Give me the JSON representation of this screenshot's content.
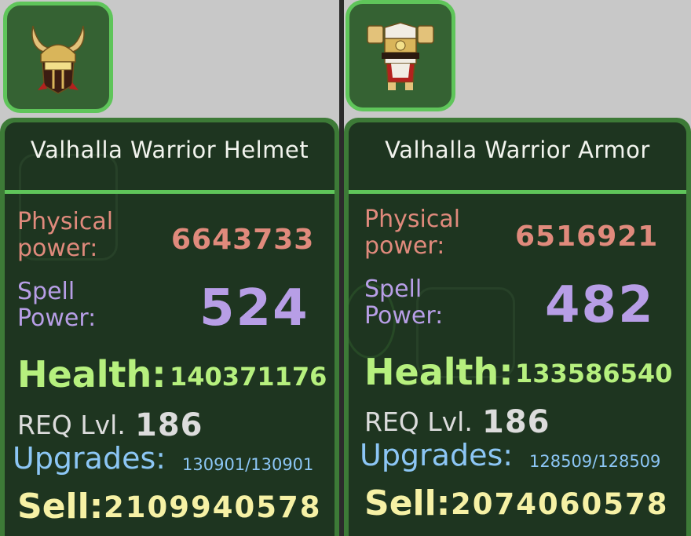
{
  "items": [
    {
      "name": "Valhalla Warrior Helmet",
      "icon": "horned-helmet-icon",
      "physical_label": "Physical power:",
      "physical_value": "6643733",
      "spell_label": "Spell Power:",
      "spell_value": "524",
      "health_label": "Health:",
      "health_value": "140371176",
      "req_label": "REQ Lvl.",
      "req_value": "186",
      "upgrades_label": "Upgrades:",
      "upgrades_value": "130901/130901",
      "sell_label": "Sell:",
      "sell_value": "2109940578"
    },
    {
      "name": "Valhalla Warrior Armor",
      "icon": "chest-armor-icon",
      "physical_label": "Physical power:",
      "physical_value": "6516921",
      "spell_label": "Spell Power:",
      "spell_value": "482",
      "health_label": "Health:",
      "health_value": "133586540",
      "req_label": "REQ Lvl.",
      "req_value": "186",
      "upgrades_label": "Upgrades:",
      "upgrades_value": "128509/128509",
      "sell_label": "Sell:",
      "sell_value": "2074060578"
    }
  ],
  "colors": {
    "card_border": "#3d7a37",
    "card_bg": "#1e3520",
    "accent_green": "#5fc55a",
    "physical": "#e08a7c",
    "spell": "#b79ee6",
    "health": "#b6f07e",
    "upgrades": "#8cc6f5",
    "sell": "#f6f1a5"
  }
}
